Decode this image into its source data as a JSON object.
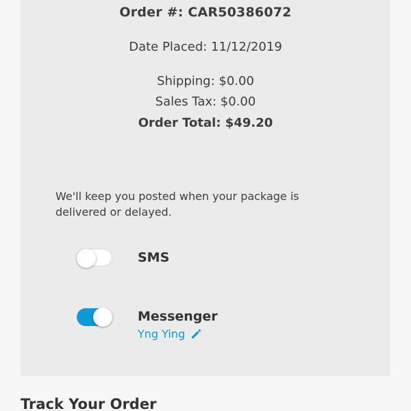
{
  "order": {
    "number_text": "Order #: CAR50386072",
    "date_placed_text": "Date Placed: 11/12/2019",
    "shipping_text": "Shipping: $0.00",
    "sales_tax_text": "Sales Tax: $0.00",
    "total_text": "Order Total: $49.20"
  },
  "notifications": {
    "notice_text": "We'll keep you posted when your package is delivered or delayed.",
    "sms": {
      "label": "SMS",
      "enabled": false
    },
    "messenger": {
      "label": "Messenger",
      "enabled": true,
      "user_name": "Yng Ying",
      "edit_icon": "pencil-icon"
    }
  },
  "tracking": {
    "heading": "Track Your Order"
  },
  "colors": {
    "panel_background": "#ebebeb",
    "page_background": "#f7f7f7",
    "accent": "#0d9ad6",
    "text": "#333333"
  }
}
